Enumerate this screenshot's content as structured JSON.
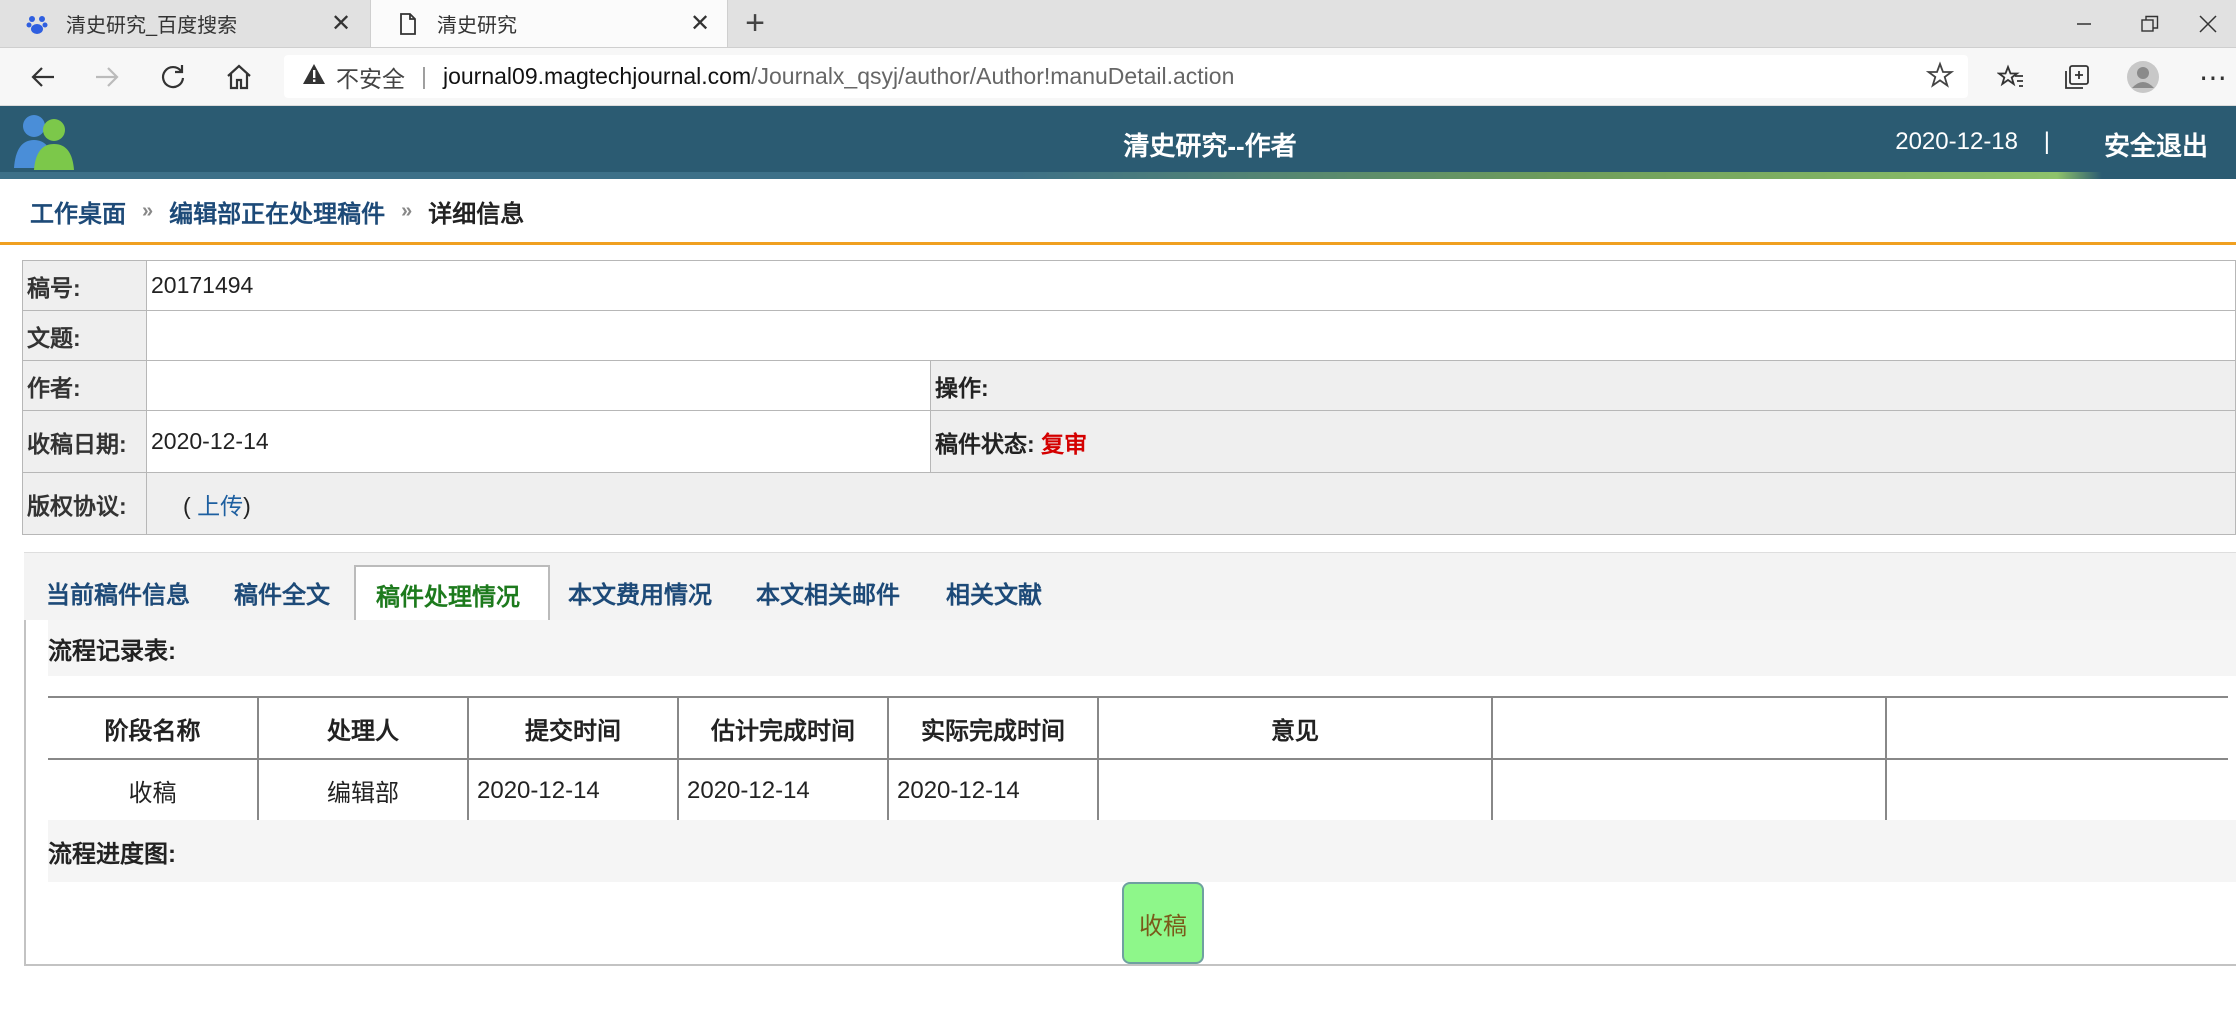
{
  "browser": {
    "tabs": [
      {
        "title": "清史研究_百度搜索",
        "icon": "baidu-paw-icon",
        "active": false
      },
      {
        "title": "清史研究",
        "icon": "page-icon",
        "active": true
      }
    ],
    "url": {
      "insecure_label": "不安全",
      "host": "journal09.magtechjournal.com",
      "path": "/Journalx_qsyj/author/Author!manuDetail.action"
    }
  },
  "header": {
    "site_title": "清史研究--作者",
    "date": "2020-12-18",
    "separator": "|",
    "logout": "安全退出"
  },
  "breadcrumb": {
    "items": [
      "工作桌面",
      "编辑部正在处理稿件"
    ],
    "separator": "»",
    "current": "详细信息"
  },
  "manuscript": {
    "id_label": "稿号:",
    "id_value": "20171494",
    "title_label": "文题:",
    "title_value": "",
    "author_label": "作者:",
    "author_value": "",
    "operation_label": "操作:",
    "received_label": "收稿日期:",
    "received_value": "2020-12-14",
    "status_label": "稿件状态:",
    "status_value": "复审",
    "copyright_label": "版权协议:",
    "copyright_open": "(",
    "copyright_link": "上传",
    "copyright_close": ")"
  },
  "tabs": [
    {
      "label": "当前稿件信息",
      "active": false
    },
    {
      "label": "稿件全文",
      "active": false
    },
    {
      "label": "稿件处理情况",
      "active": true
    },
    {
      "label": "本文费用情况",
      "active": false
    },
    {
      "label": "本文相关邮件",
      "active": false
    },
    {
      "label": "相关文献",
      "active": false
    }
  ],
  "flow_table": {
    "title": "流程记录表:",
    "columns": [
      "阶段名称",
      "处理人",
      "提交时间",
      "估计完成时间",
      "实际完成时间",
      "意见",
      "",
      ""
    ],
    "rows": [
      [
        "收稿",
        "编辑部",
        "2020-12-14",
        "2020-12-14",
        "2020-12-14",
        "",
        "",
        ""
      ]
    ]
  },
  "flow_chart": {
    "title": "流程进度图:",
    "nodes": [
      "收稿"
    ]
  },
  "colors": {
    "header_bg": "#2b5b72",
    "breadcrumb_underline": "#f0a020",
    "status_red": "#d40000",
    "active_tab_text": "#1d7a1d",
    "node_green": "#8ef78a"
  }
}
